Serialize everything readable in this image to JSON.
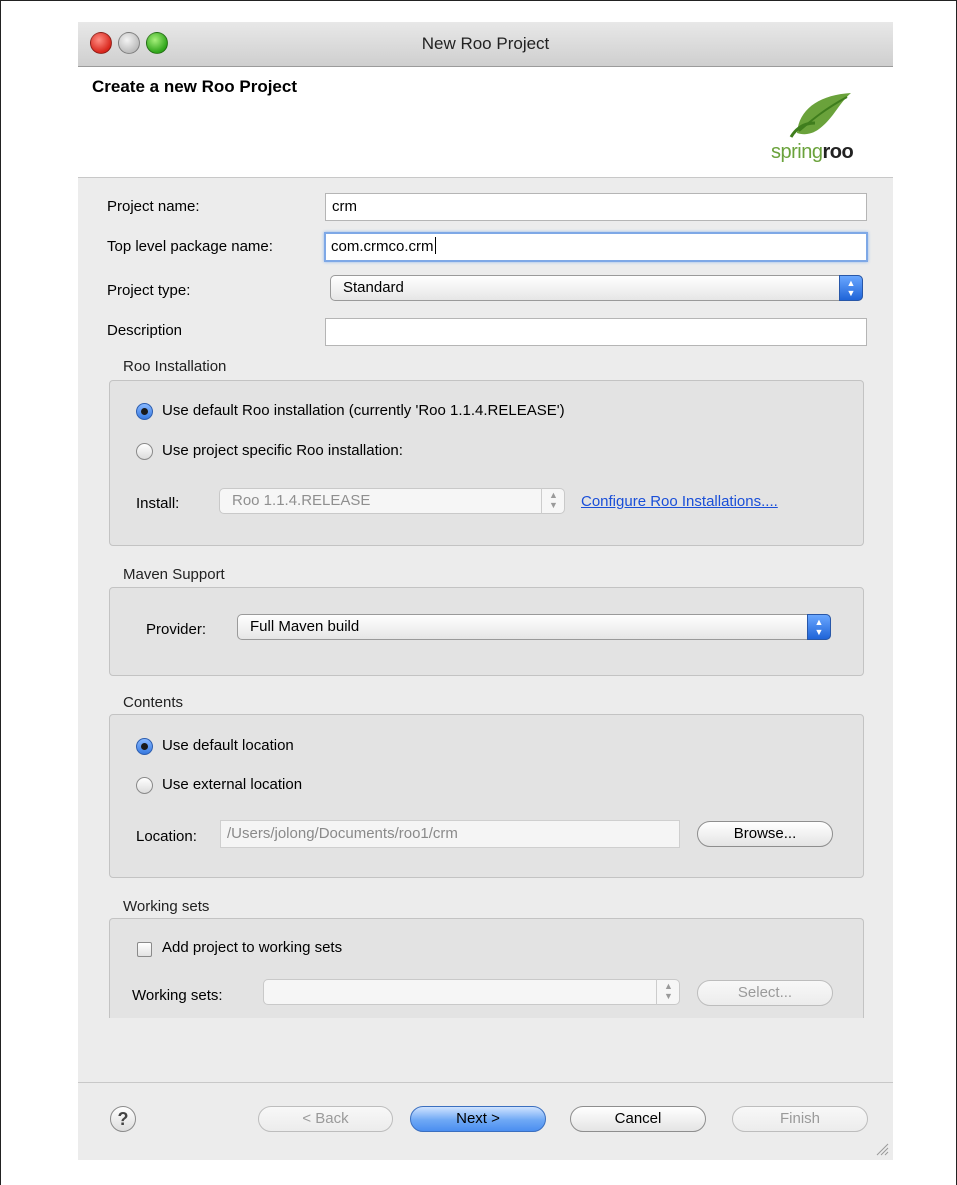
{
  "window": {
    "title": "New Roo Project"
  },
  "header": {
    "title": "Create a new Roo Project",
    "logo": {
      "spring": "spring",
      "roo": "roo"
    }
  },
  "form": {
    "project_name": {
      "label": "Project name:",
      "value": "crm"
    },
    "package_name": {
      "label": "Top level package name:",
      "value": "com.crmco.crm"
    },
    "project_type": {
      "label": "Project type:",
      "value": "Standard"
    },
    "description": {
      "label": "Description",
      "value": ""
    }
  },
  "roo_installation": {
    "title": "Roo Installation",
    "option_default": "Use default Roo installation (currently 'Roo 1.1.4.RELEASE')",
    "option_specific": "Use project specific Roo installation:",
    "install_label": "Install:",
    "install_value": "Roo 1.1.4.RELEASE",
    "configure_link": "Configure Roo Installations...."
  },
  "maven": {
    "title": "Maven Support",
    "provider_label": "Provider:",
    "provider_value": "Full Maven build"
  },
  "contents": {
    "title": "Contents",
    "option_default": "Use default location",
    "option_external": "Use external location",
    "location_label": "Location:",
    "location_value": "/Users/jolong/Documents/roo1/crm",
    "browse": "Browse..."
  },
  "working_sets": {
    "title": "Working sets",
    "add_label": "Add project to working sets",
    "sets_label": "Working sets:",
    "select": "Select..."
  },
  "footer": {
    "help": "?",
    "back": "< Back",
    "next": "Next >",
    "cancel": "Cancel",
    "finish": "Finish"
  },
  "colors": {
    "accent_blue": "#4b8ef0",
    "link": "#1a4fd8",
    "spring_green": "#6aa23b"
  }
}
